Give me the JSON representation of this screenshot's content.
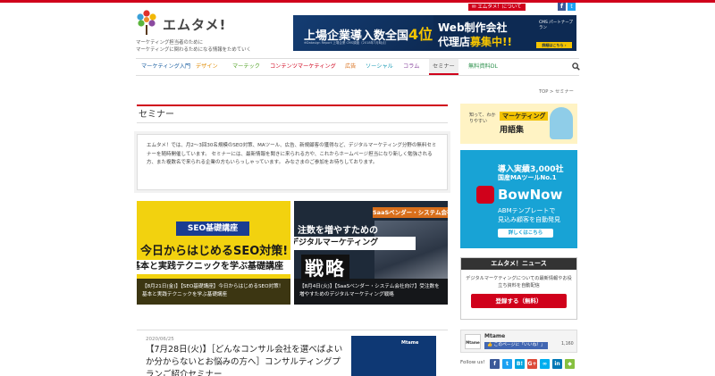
{
  "header": {
    "logo_text": "エムタメ!",
    "tagline_1": "マーケティング担当者のために",
    "tagline_2": "マーケティングに関わるためになる情報をためていく",
    "about_link": "エムタメ！について",
    "sns": {
      "facebook": "f",
      "twitter": "t"
    }
  },
  "banner": {
    "left_title": "上場企業導入数全国",
    "left_rank": "4位",
    "left_note": "※Datasign Report 上場企業 CMS調査（2018年7月時点）",
    "right_line1": "Web制作会社",
    "right_line2_a": "代理店",
    "right_line2_b": "募集中!!",
    "cms_label": "CMS パートナープラン",
    "cta": "詳細はこちら ›"
  },
  "nav": {
    "items": [
      "マーケティング入門",
      "デザイン",
      "マーテック",
      "コンテンツマーケティング",
      "広告",
      "ソーシャル",
      "コラム",
      "セミナー",
      "無料資料DL"
    ],
    "colors": [
      "#1a5ea0",
      "#e08a00",
      "#54a32a",
      "#d0011b",
      "#d96f1b",
      "#1a9bb5",
      "#8b4aa0",
      "#555555",
      "#2a8f4a"
    ],
    "active_index": 7
  },
  "breadcrumb": {
    "home": "TOP",
    "sep": ">",
    "current": "セミナー"
  },
  "main": {
    "page_title": "セミナー",
    "intro": "エムタメ！では、月2〜3回30名規模のSEO対策、MAツール、広告、新規顧客の獲得など、デジタルマーケティング分野の無料セミナーを随時開催しています。 セミナーには、最新情報を聞きに来られる方や、これからホームページ担当になり新しく勉強される方、また複数名で来られる企業の方もいらっしゃっています。 みなさまのご参加をお待ちしております。"
  },
  "cards": [
    {
      "badge": "SEO基礎講座",
      "main": "今日からはじめるSEO対策!",
      "sub": "基本と実践テクニックを学ぶ基礎講座",
      "caption": "【8月21日(金)】【SEO基礎講座】今日からはじめるSEO対策！基本と実践テクニックを学ぶ基礎講座"
    },
    {
      "tag": "SaaSベンダー・システム会社",
      "line1": "注数を増やすための",
      "line2": "デジタルマーケティング",
      "big": "戦略",
      "caption": "【8月4日(火)】【SaaSベンダー・システム会社向け】受注数を増やすためのデジタルマーケティング戦略"
    }
  ],
  "post": {
    "date": "2020/06/25",
    "title": "【7月28日(火)】［どんなコンサル会社を選べばよいか分からないとお悩みの方へ］コンサルティングプランご紹介セミナー",
    "thumb_brand": "Mtame"
  },
  "sidebar": {
    "glossary": {
      "small": "知って、わかりやすい",
      "tag": "マーケティング",
      "title": "用語集"
    },
    "bownow": {
      "line1": "導入実績3,000社",
      "line2": "国産MAツールNo.1",
      "brand": "BowNow",
      "line3": "ABMテンプレートで",
      "line4": "見込み顧客を自動発見",
      "cta": "詳しくはこちら"
    },
    "news": {
      "heading": "エムタメ！ニュース",
      "desc": "デジタルマーケティングについての最新情報やお役立ち資料を自動配信",
      "button": "登録する（無料）"
    },
    "facebook": {
      "logo": "Mtame",
      "name": "Mtame",
      "like": "このページに「いいね！」",
      "count": "1,160"
    },
    "follow": {
      "label": "Follow us!",
      "icons": [
        {
          "glyph": "f",
          "color": "#3b5998"
        },
        {
          "glyph": "t",
          "color": "#1da1f2"
        },
        {
          "glyph": "B!",
          "color": "#00a4de"
        },
        {
          "glyph": "G+",
          "color": "#dd4b39"
        },
        {
          "glyph": "∞",
          "color": "#00aeef"
        },
        {
          "glyph": "in",
          "color": "#0077b5"
        },
        {
          "glyph": "◆",
          "color": "#87c040"
        }
      ]
    }
  }
}
